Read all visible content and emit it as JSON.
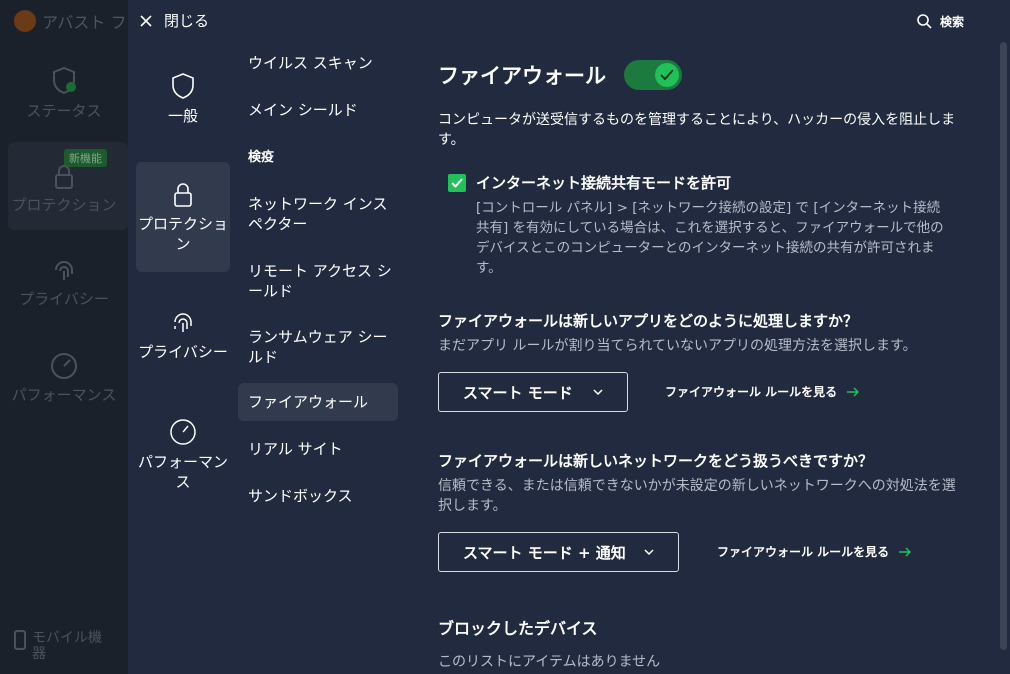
{
  "background_app": {
    "title": "アバスト フ",
    "nav": [
      {
        "label": "ステータス"
      },
      {
        "label": "プロテクション",
        "badge": "新機能"
      },
      {
        "label": "プライバシー"
      },
      {
        "label": "パフォーマンス"
      }
    ],
    "mobile_label": "モバイル機\n器"
  },
  "header": {
    "close_label": "閉じる",
    "search_label": "検索"
  },
  "categories": [
    {
      "label": "一般"
    },
    {
      "label": "プロテクショ\nン"
    },
    {
      "label": "プライバシー"
    },
    {
      "label": "パフォーマン\nス"
    }
  ],
  "subnav": [
    {
      "label": "ウイルス スキャン"
    },
    {
      "label": "メイン シールド"
    },
    {
      "label": "検疫"
    },
    {
      "label": "ネットワーク インス\nペクター"
    },
    {
      "label": "リモート アクセス シ\nールド"
    },
    {
      "label": "ランサムウェア シー\nルド"
    },
    {
      "label": "ファイアウォール"
    },
    {
      "label": "リアル サイト"
    },
    {
      "label": "サンドボックス"
    }
  ],
  "firewall": {
    "title": "ファイアウォール",
    "enabled": true,
    "description": "コンピュータが送受信するものを管理することにより、ハッカーの侵入を阻止しま\nす。",
    "ics_label": "インターネット接続共有モードを許可",
    "ics_checked": true,
    "ics_help": "[コントロール パネル] > [ネットワーク接続の設定] で [インターネット接続\n共有] を有効にしている場合は、これを選択すると、ファイアウォールで他の\nデバイスとこのコンピューターとのインターネット接続の共有が許可されま\nす。",
    "apps_question": "ファイアウォールは新しいアプリをどのように処理しますか？",
    "apps_help": "まだアプリ ルールが割り当てられていないアプリの処理方法を選択します。",
    "apps_mode": "スマート モード",
    "rules_link": "ファイアウォール ルールを見る",
    "network_question": "ファイアウォールは新しいネットワークをどう扱うべきですか？",
    "network_help": "信頼できる、または信頼できないかが未設定の新しいネットワークへの対処法を選\n択します。",
    "network_mode": "スマート モード + 通知",
    "blocked_title": "ブロックしたデバイス",
    "blocked_empty": "このリストにアイテムはありません"
  },
  "colors": {
    "panel_bg": "#212a3e",
    "accent_green": "#21c15a",
    "active_item_bg": "#323b4e"
  }
}
